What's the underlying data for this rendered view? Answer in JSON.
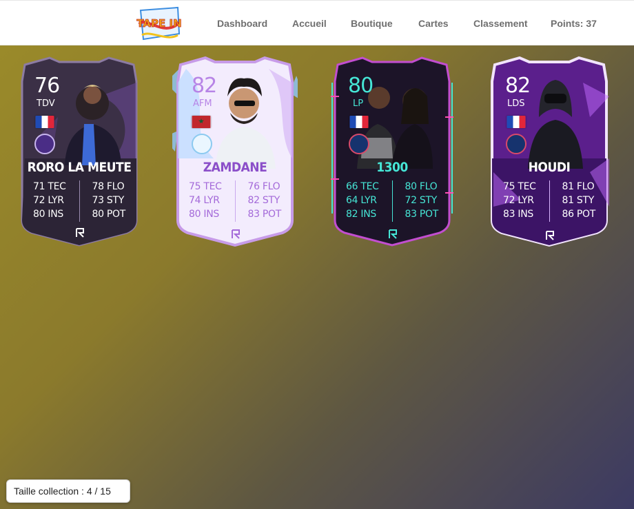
{
  "nav": {
    "logo_text": "TAPE IN",
    "links": [
      "Dashboard",
      "Accueil",
      "Boutique",
      "Cartes",
      "Classement"
    ],
    "points_label": "Points: 37"
  },
  "cards": [
    {
      "rating": "76",
      "club": "TDV",
      "flag": "france",
      "name": "RORO LA MEUTE",
      "stats_left": [
        "71 TEC",
        "72 LYR",
        "80 INS"
      ],
      "stats_right": [
        "78 FLO",
        "73 STY",
        "80 POT"
      ],
      "colors": {
        "frame": "#7b6c8f",
        "bg": "#3a3042",
        "text": "#ffffff",
        "accent": "#8a6fc0"
      }
    },
    {
      "rating": "82",
      "club": "AFM",
      "flag": "morocco",
      "name": "ZAMDANE",
      "stats_left": [
        "75 TEC",
        "74 LYR",
        "80 INS"
      ],
      "stats_right": [
        "76 FLO",
        "82 STY",
        "83 POT"
      ],
      "colors": {
        "frame": "#c79be8",
        "bg": "#f1eafc",
        "text": "#8b4fc9",
        "accent": "#6ab7ff"
      }
    },
    {
      "rating": "80",
      "club": "LP",
      "flag": "france",
      "name": "1300",
      "stats_left": [
        "66 TEC",
        "64 LYR",
        "82 INS"
      ],
      "stats_right": [
        "80 FLO",
        "72 STY",
        "83 POT"
      ],
      "colors": {
        "frame": "#c04cc0",
        "bg": "#1e1730",
        "text": "#46e6d6",
        "accent": "#ff4fb3"
      }
    },
    {
      "rating": "82",
      "club": "LDS",
      "flag": "france",
      "name": "HOUDI",
      "stats_left": [
        "75 TEC",
        "72 LYR",
        "83 INS"
      ],
      "stats_right": [
        "81 FLO",
        "81 STY",
        "86 POT"
      ],
      "colors": {
        "frame": "#e4c6ff",
        "bg": "#5b1f8c",
        "text": "#ffffff",
        "accent": "#c46cff"
      }
    }
  ],
  "collection_label": "Taille collection : 4 / 15"
}
